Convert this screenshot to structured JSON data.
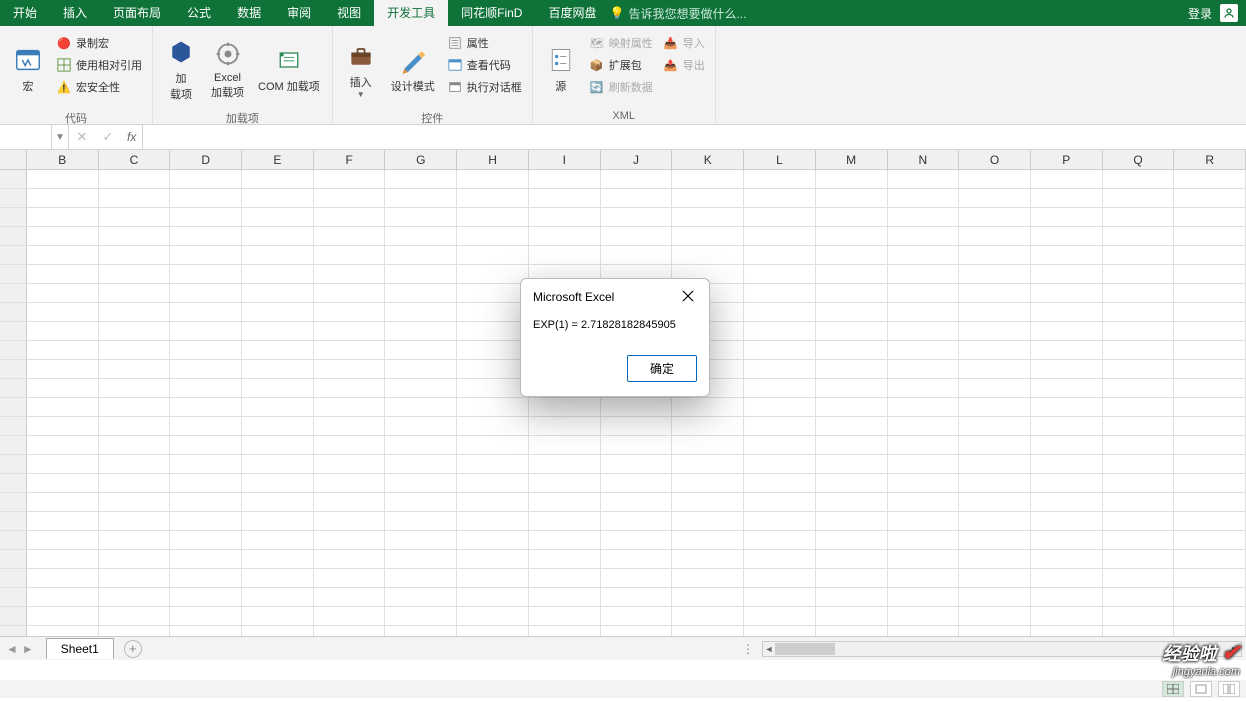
{
  "menu": {
    "items": [
      "开始",
      "插入",
      "页面布局",
      "公式",
      "数据",
      "审阅",
      "视图",
      "开发工具",
      "同花顺FinD",
      "百度网盘"
    ],
    "active_index": 7,
    "tell_me": "告诉我您想要做什么...",
    "login": "登录"
  },
  "ribbon": {
    "group_code": {
      "label": "代码",
      "macro": "宏",
      "record": "录制宏",
      "relative": "使用相对引用",
      "security": "宏安全性"
    },
    "group_addins": {
      "label": "加载项",
      "addins": "加\n载项",
      "excel_addins": "Excel\n加载项",
      "com_addins": "COM 加载项"
    },
    "group_controls": {
      "label": "控件",
      "insert": "插入",
      "design": "设计模式",
      "properties": "属性",
      "view_code": "查看代码",
      "run_dialog": "执行对话框"
    },
    "group_xml": {
      "label": "XML",
      "source": "源",
      "map_props": "映射属性",
      "expansion": "扩展包",
      "refresh": "刷新数据",
      "import": "导入",
      "export": "导出"
    }
  },
  "formula_bar": {
    "name_box": "",
    "fx": "fx",
    "formula": ""
  },
  "columns": [
    "B",
    "C",
    "D",
    "E",
    "F",
    "G",
    "H",
    "I",
    "J",
    "K",
    "L",
    "M",
    "N",
    "O",
    "P",
    "Q",
    "R"
  ],
  "sheet": {
    "active": "Sheet1"
  },
  "dialog": {
    "title": "Microsoft Excel",
    "message": "EXP(1) = 2.71828182845905",
    "ok": "确定"
  },
  "watermark": {
    "line1": "经验啦",
    "line2": "jingyanla.com"
  }
}
